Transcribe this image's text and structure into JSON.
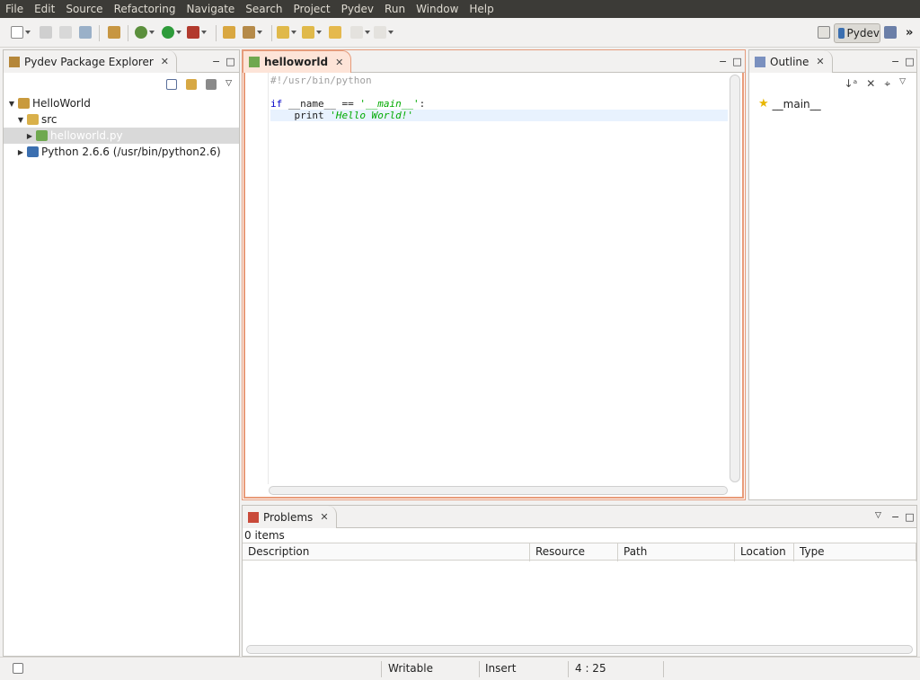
{
  "menu": [
    "File",
    "Edit",
    "Source",
    "Refactoring",
    "Navigate",
    "Search",
    "Project",
    "Pydev",
    "Run",
    "Window",
    "Help"
  ],
  "perspective": {
    "label": "Pydev",
    "overflow": "»"
  },
  "explorer": {
    "tab_label": "Pydev Package Explorer",
    "tree": [
      {
        "label": "HelloWorld",
        "level": 0,
        "twisty": "▼",
        "icon_color": "#c99a3d"
      },
      {
        "label": "src",
        "level": 1,
        "twisty": "▼",
        "icon_color": "#d9b04a"
      },
      {
        "label": "helloworld.py",
        "level": 2,
        "twisty": "▶",
        "icon_color": "#6fa84f",
        "selected": true
      },
      {
        "label": "Python 2.6.6  (/usr/bin/python2.6)",
        "level": 1,
        "twisty": "▶",
        "icon_color": "#3b6fb0"
      }
    ]
  },
  "editor": {
    "tab_label": "helloworld",
    "lines": [
      {
        "tokens": [
          {
            "t": "#!/usr/bin/python",
            "c": "c-comment"
          }
        ]
      },
      {
        "tokens": []
      },
      {
        "tokens": [
          {
            "t": "if",
            "c": "c-kw"
          },
          {
            "t": " __name__ == ",
            "c": ""
          },
          {
            "t": "'__main__'",
            "c": "c-str"
          },
          {
            "t": ":",
            "c": ""
          }
        ]
      },
      {
        "tokens": [
          {
            "t": "    print ",
            "c": ""
          },
          {
            "t": "'Hello World!'",
            "c": "c-str"
          }
        ],
        "current": true
      }
    ]
  },
  "outline": {
    "tab_label": "Outline",
    "items": [
      {
        "label": "__main__",
        "icon": "star-icon"
      }
    ]
  },
  "problems": {
    "tab_label": "Problems",
    "count": "0 items",
    "columns": [
      "Description",
      "Resource",
      "Path",
      "Location",
      "Type"
    ]
  },
  "status": {
    "mode": "Writable",
    "insert": "Insert",
    "position": "4 : 25"
  }
}
